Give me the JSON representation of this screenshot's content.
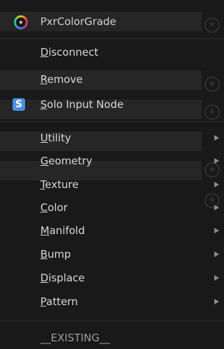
{
  "header": {
    "title": "PxrColorGrade",
    "icon": "color-wheel-icon"
  },
  "actions": [
    {
      "label": "Disconnect"
    },
    {
      "label": "Remove"
    },
    {
      "label": "Solo Input Node",
      "icon": "solo-s-icon",
      "icon_letter": "S",
      "icon_color": "#4a8fe0"
    }
  ],
  "submenus": [
    {
      "label": "Utility"
    },
    {
      "label": "Geometry"
    },
    {
      "label": "Texture"
    },
    {
      "label": "Color"
    },
    {
      "label": "Manifold"
    },
    {
      "label": "Bump"
    },
    {
      "label": "Displace"
    },
    {
      "label": "Pattern"
    }
  ],
  "footer": {
    "label": "__EXISTING__"
  },
  "colors": {
    "menu_bg": "#191919",
    "text": "#d8d8d8",
    "separator": "#2e2e2e",
    "arrow": "#8a8a8a"
  }
}
